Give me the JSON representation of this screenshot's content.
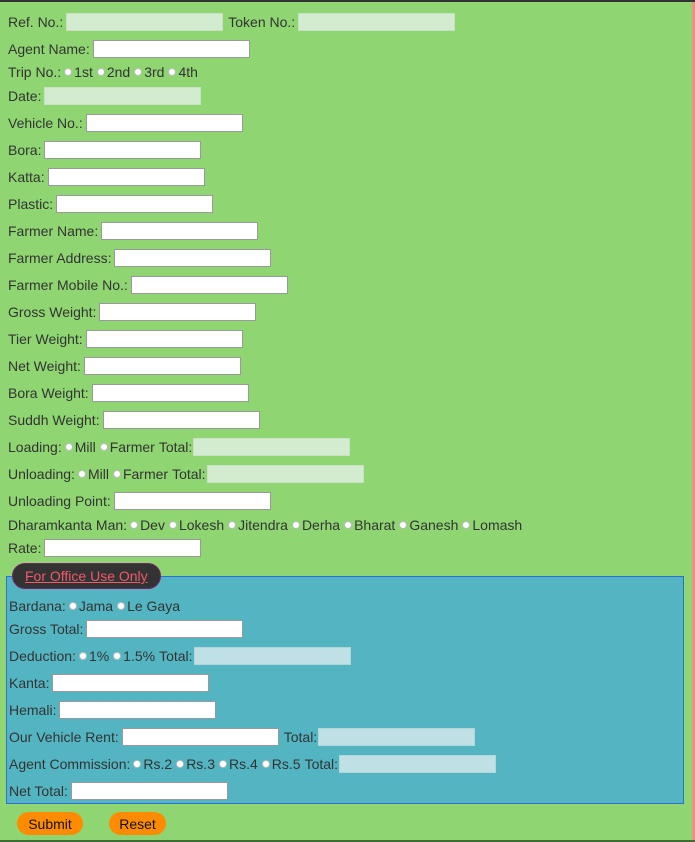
{
  "form": {
    "ref_no_label": "Ref. No.:",
    "token_no_label": "Token No.:",
    "agent_name_label": "Agent Name:",
    "trip_no_label": "Trip No.:",
    "trip_options": [
      "1st",
      "2nd",
      "3rd",
      "4th"
    ],
    "date_label": "Date:",
    "vehicle_no_label": "Vehicle No.:",
    "bora_label": "Bora:",
    "katta_label": "Katta:",
    "plastic_label": "Plastic:",
    "farmer_name_label": "Farmer Name:",
    "farmer_address_label": "Farmer Address:",
    "farmer_mobile_label": "Farmer Mobile No.:",
    "gross_weight_label": "Gross Weight:",
    "tier_weight_label": "Tier Weight:",
    "net_weight_label": "Net Weight:",
    "bora_weight_label": "Bora Weight:",
    "suddh_weight_label": "Suddh Weight:",
    "loading_label": "Loading:",
    "loading_options": [
      "Mill",
      "Farmer"
    ],
    "loading_total_label": "Total:",
    "unloading_label": "Unloading:",
    "unloading_options": [
      "Mill",
      "Farmer"
    ],
    "unloading_total_label": "Total:",
    "unloading_point_label": "Unloading Point:",
    "dharamkanta_label": "Dharamkanta Man:",
    "dharamkanta_options": [
      "Dev",
      "Lokesh",
      "Jitendra",
      "Derha",
      "Bharat",
      "Ganesh",
      "Lomash"
    ],
    "rate_label": "Rate:"
  },
  "office": {
    "legend": "For Office Use Only",
    "bardana_label": "Bardana:",
    "bardana_options": [
      "Jama",
      "Le Gaya"
    ],
    "gross_total_label": "Gross Total:",
    "deduction_label": "Deduction:",
    "deduction_options": [
      "1%",
      "1.5%"
    ],
    "deduction_total_label": "Total:",
    "kanta_label": "Kanta:",
    "hemali_label": "Hemali:",
    "vehicle_rent_label": "Our Vehicle Rent:",
    "vehicle_rent_total_label": "Total:",
    "agent_commission_label": "Agent Commission:",
    "agent_commission_options": [
      "Rs.2",
      "Rs.3",
      "Rs.4",
      "Rs.5"
    ],
    "agent_commission_total_label": "Total:",
    "net_total_label": "Net Total:"
  },
  "buttons": {
    "submit": "Submit",
    "reset": "Reset"
  }
}
